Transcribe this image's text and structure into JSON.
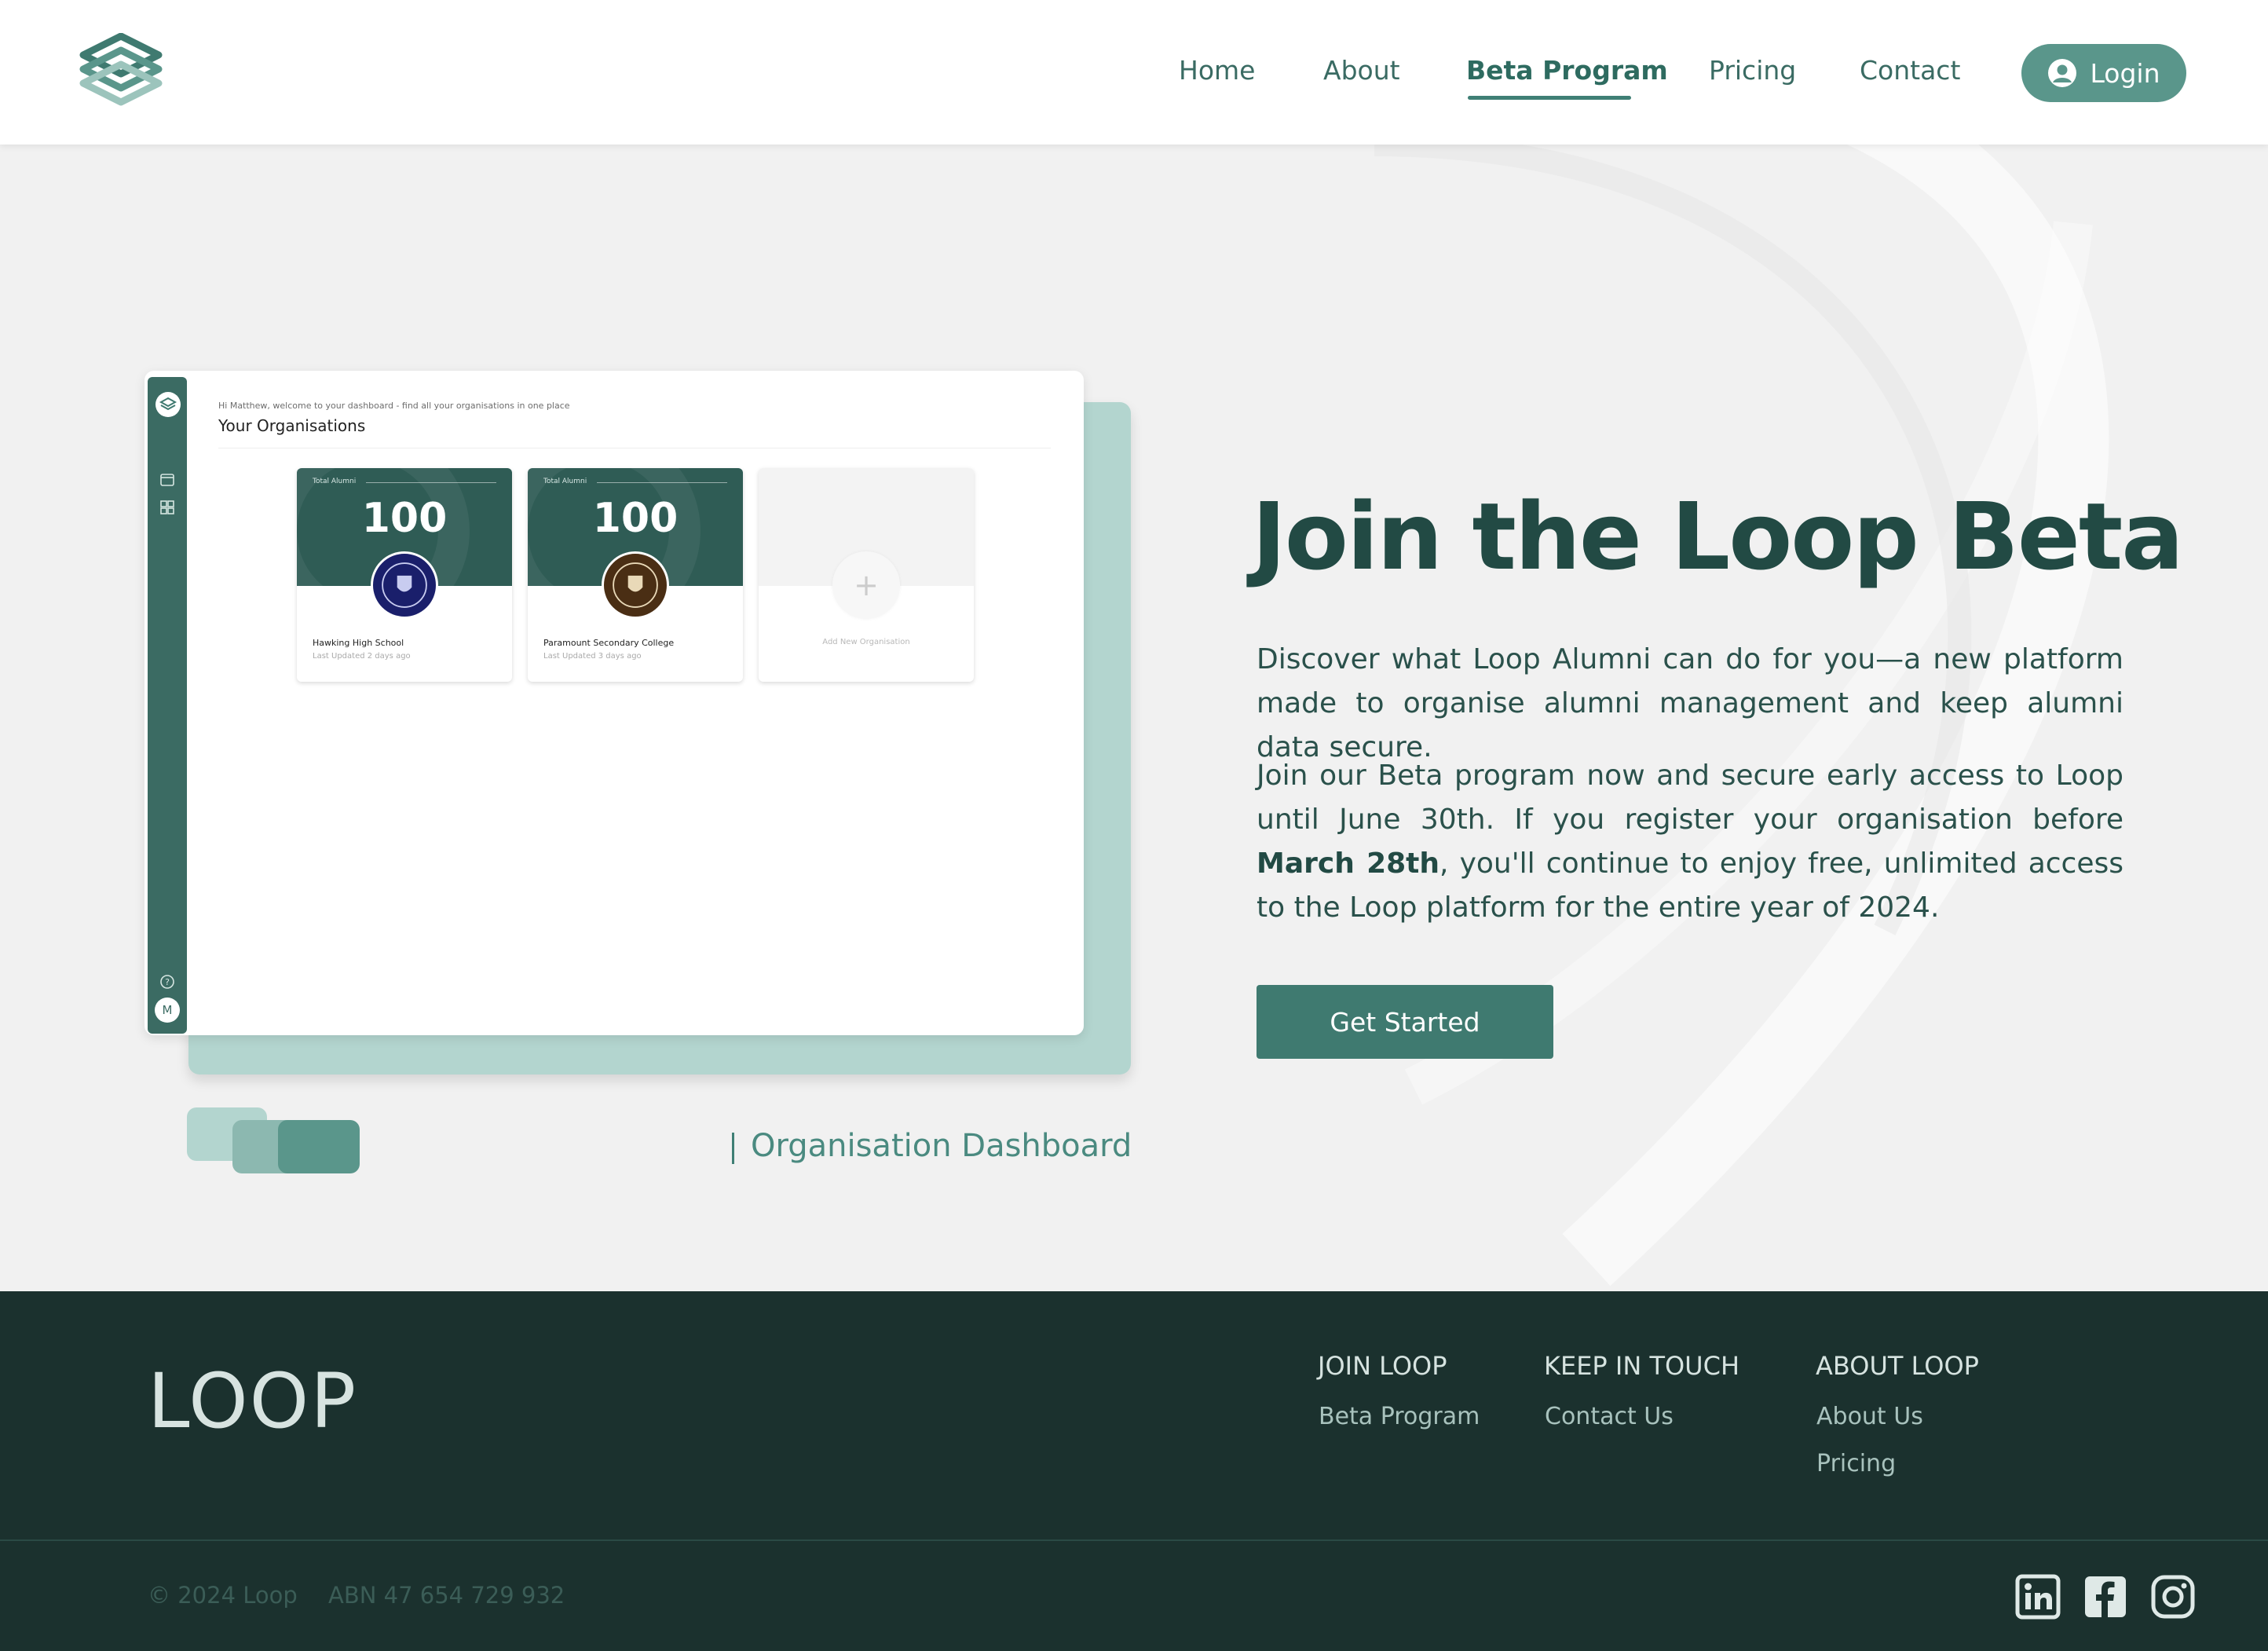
{
  "header": {
    "nav": [
      {
        "label": "Home"
      },
      {
        "label": "About"
      },
      {
        "label": "Beta Program",
        "active": true
      },
      {
        "label": "Pricing"
      },
      {
        "label": "Contact"
      }
    ],
    "login_label": "Login"
  },
  "hero": {
    "mockup": {
      "greeting": "Hi Matthew, welcome to your dashboard - find all your organisations in one place",
      "title": "Your Organisations",
      "cards": [
        {
          "label": "Total Alumni",
          "value": "100",
          "name": "Hawking High School",
          "updated": "Last Updated 2 days ago",
          "crest_color": "#1a1f6b"
        },
        {
          "label": "Total Alumni",
          "value": "100",
          "name": "Paramount Secondary College",
          "updated": "Last Updated 3 days ago",
          "crest_color": "#4a2e14"
        }
      ],
      "add_card_label": "Add New Organisation",
      "user_initial": "M"
    },
    "caption": "Organisation Dashboard",
    "title": "Join the Loop Beta",
    "paragraph1": "Discover what Loop Alumni can do for you—a new platform made to organise alumni management and keep alumni data secure.",
    "paragraph2_before": "Join our Beta program now and secure early access to Loop until June 30th. If you register your organisation before ",
    "paragraph2_bold": "March 28th",
    "paragraph2_after": ", you'll continue to enjoy free, unlimited access to the Loop platform for the entire year of 2024.",
    "cta_label": "Get Started"
  },
  "footer": {
    "brand": "LOOP",
    "columns": [
      {
        "title": "JOIN LOOP",
        "links": [
          "Beta Program"
        ]
      },
      {
        "title": "KEEP IN TOUCH",
        "links": [
          "Contact Us"
        ]
      },
      {
        "title": "ABOUT LOOP",
        "links": [
          "About Us",
          "Pricing"
        ]
      }
    ],
    "copyright": "© 2024 Loop",
    "abn": "ABN 47 654 729 932",
    "social_icons": [
      "linkedin-icon",
      "facebook-icon",
      "instagram-icon"
    ]
  },
  "colors": {
    "accent": "#3f7a70",
    "dark": "#1b312e",
    "heading": "#224a44",
    "hero_bg": "#f1f1f1"
  }
}
